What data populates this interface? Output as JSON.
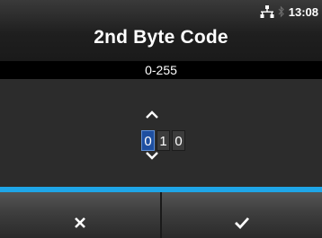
{
  "header": {
    "title": "2nd Byte Code",
    "time": "13:08",
    "icons": [
      "network-icon",
      "bluetooth-icon"
    ]
  },
  "range": {
    "text": "0-255"
  },
  "value": {
    "digits": [
      "0",
      "1",
      "0"
    ],
    "selected_index": 0
  },
  "footer": {
    "left_icon": "close-icon",
    "right_icon": "check-icon"
  },
  "colors": {
    "accent": "#1fa6e8",
    "selected_digit": "#1e4fa0"
  }
}
